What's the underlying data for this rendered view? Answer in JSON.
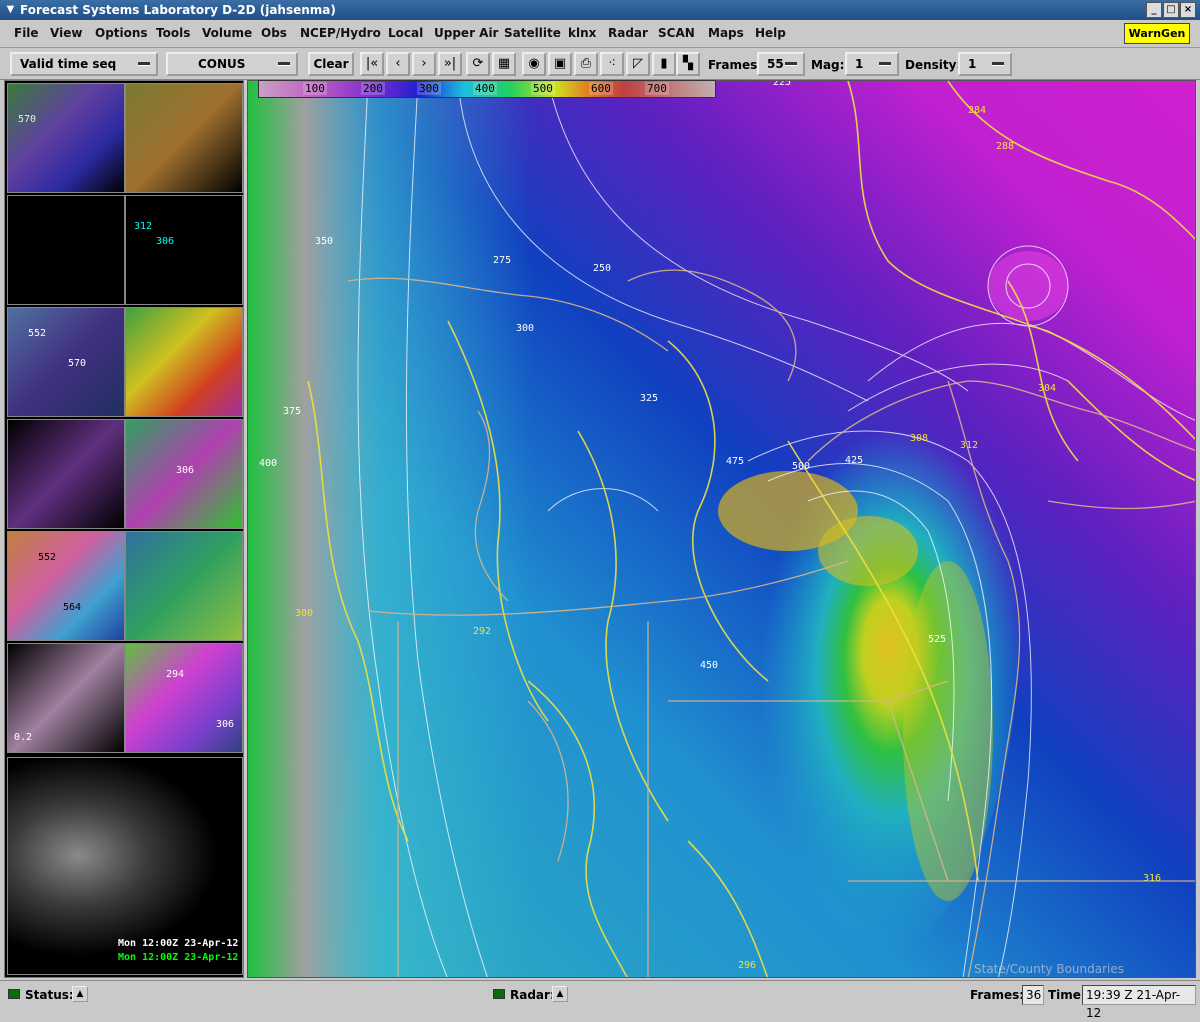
{
  "window": {
    "title": "Forecast Systems Laboratory D-2D (jahsenma)"
  },
  "menu": {
    "items": [
      "File",
      "View",
      "Options",
      "Tools",
      "Volume",
      "Obs",
      "NCEP/Hydro",
      "Local",
      "Upper Air",
      "Satellite",
      "klnx",
      "Radar",
      "SCAN",
      "Maps",
      "Help"
    ],
    "warngen": "WarnGen"
  },
  "toolbar": {
    "time_mode": "Valid time seq",
    "scale": "CONUS",
    "clear": "Clear",
    "frames_label": "Frames:",
    "frames_value": "55",
    "mag_label": "Mag:",
    "mag_value": "1",
    "density_label": "Density:",
    "density_value": "1"
  },
  "colorbar": {
    "ticks": [
      "100",
      "200",
      "300",
      "400",
      "500",
      "600",
      "700"
    ]
  },
  "sidebar": {
    "thumb_labels": [
      "570",
      "306",
      "312",
      "552",
      "570",
      "306",
      "552",
      "564",
      "294",
      "306",
      "0.2"
    ],
    "time_line1": "Mon 12:00Z 23-Apr-12",
    "time_line2": "Mon 12:00Z 23-Apr-12"
  },
  "map": {
    "overlay_label": "State/County Boundaries",
    "contour_labels_white": [
      "225",
      "250",
      "275",
      "300",
      "325",
      "350",
      "375",
      "400",
      "425",
      "450",
      "475",
      "500",
      "525"
    ],
    "contour_labels_yellow": [
      "284",
      "288",
      "292",
      "296",
      "300",
      "304",
      "308",
      "312",
      "316"
    ]
  },
  "status": {
    "status_label": "Status:",
    "radar_label": "Radar:",
    "frames_label": "Frames:",
    "frames_value": "36",
    "time_label": "Time:",
    "time_value": "19:39 Z 21-Apr-12"
  },
  "colors": {
    "accent": "#ffff00",
    "title": "#1f4f86"
  }
}
